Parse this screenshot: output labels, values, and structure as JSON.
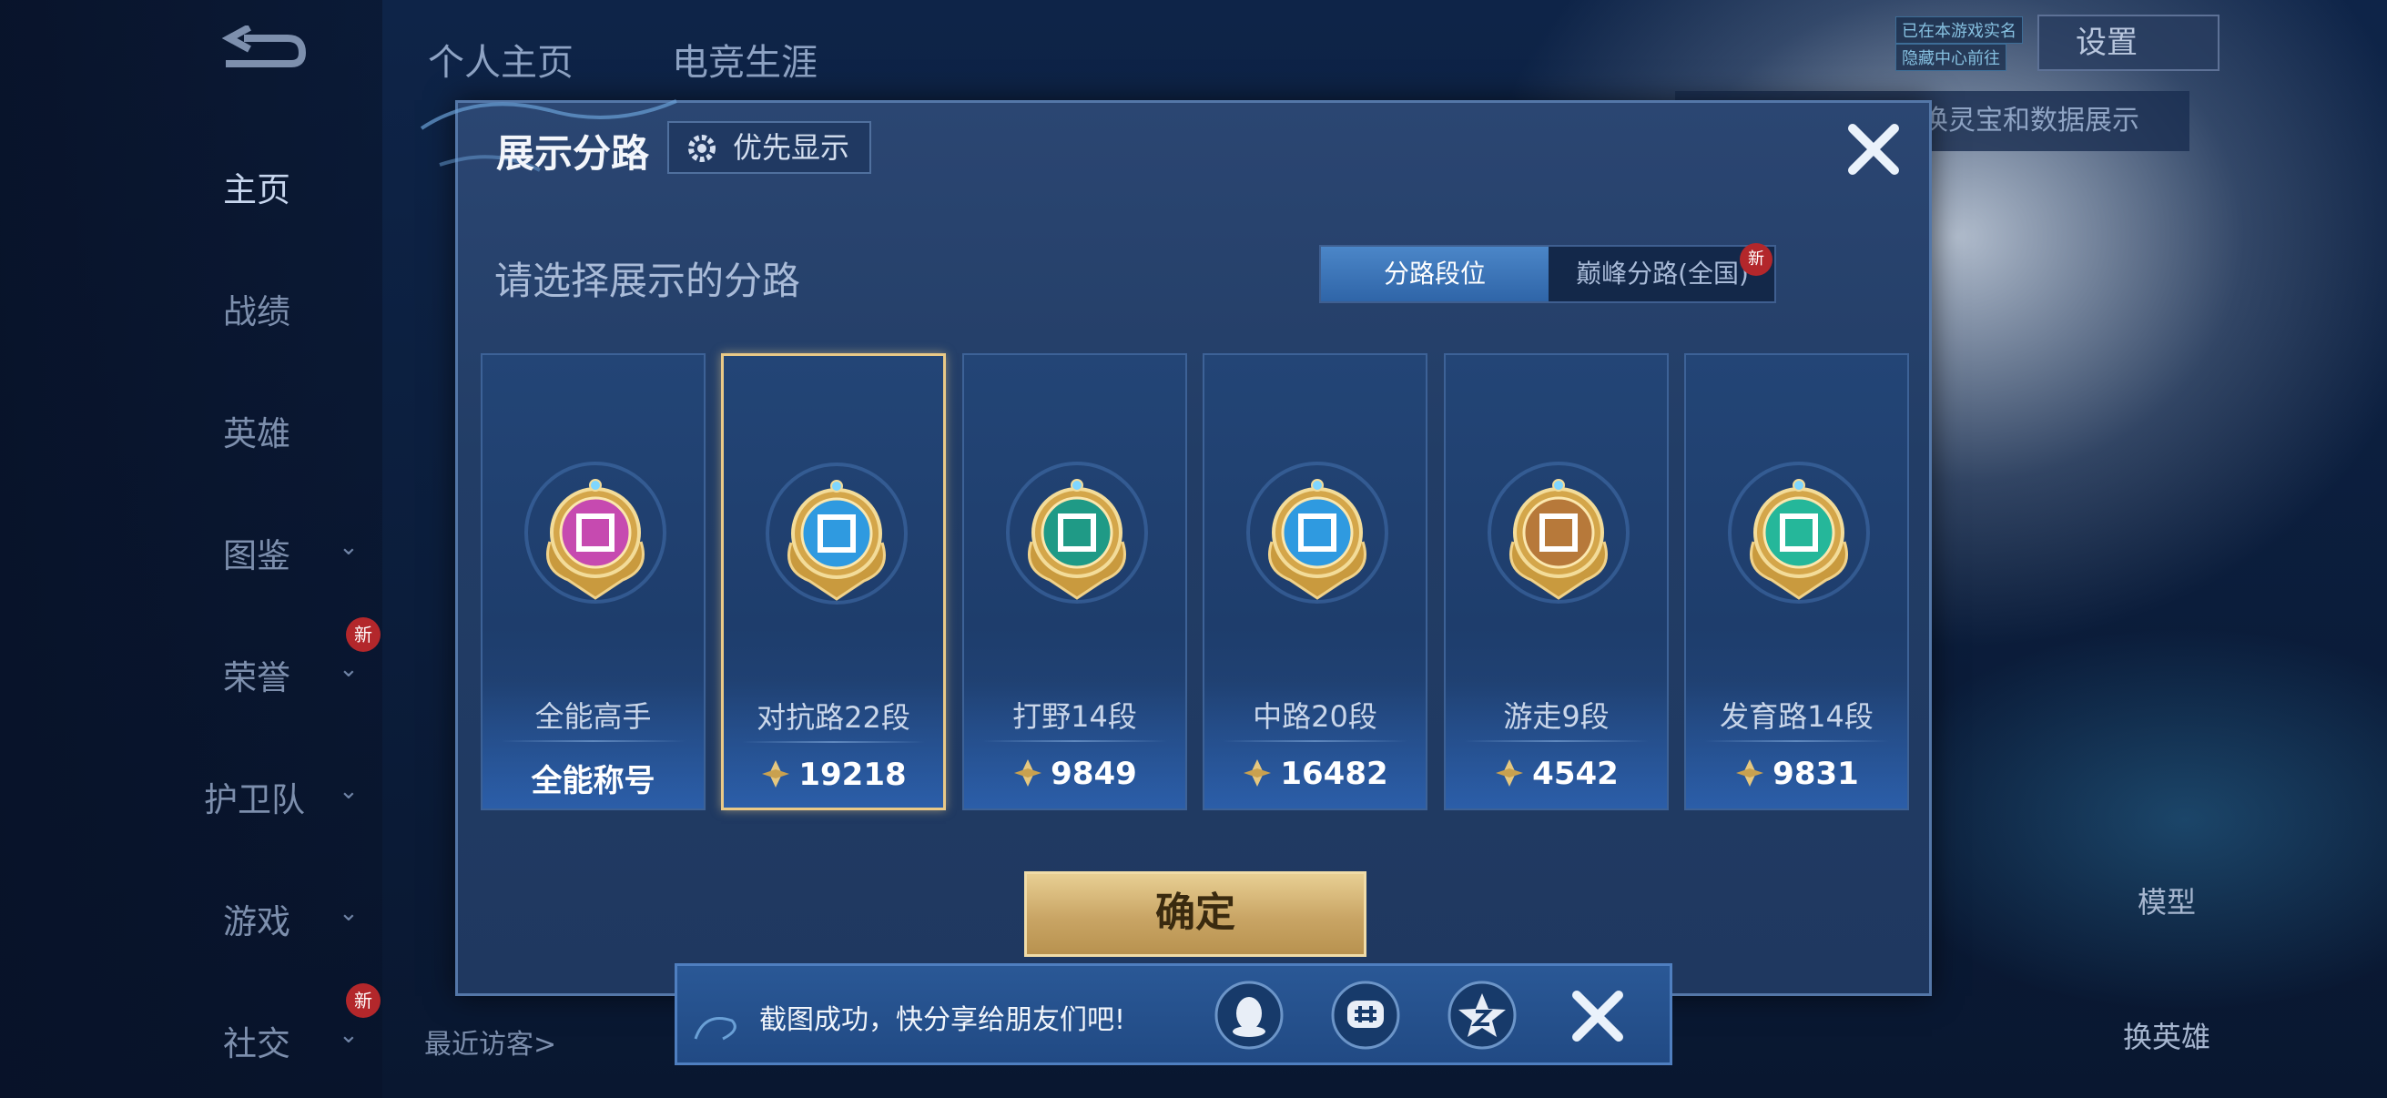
{
  "background": {
    "top_tabs": [
      "个人主页",
      "电竞生涯"
    ],
    "sidebar": [
      {
        "label": "主页",
        "active": true
      },
      {
        "label": "战绩"
      },
      {
        "label": "英雄"
      },
      {
        "label": "图鉴"
      },
      {
        "label": "荣誉"
      },
      {
        "label": "护卫队"
      },
      {
        "label": "游戏"
      },
      {
        "label": "社交"
      }
    ],
    "new_badge": "新",
    "settings_label": "设置",
    "tag_line1": "已在本游戏实名",
    "tag_line2": "隐藏中心前往",
    "banner_text": "换灵宝和数据展示",
    "model_label": "模型",
    "change_hero_label": "换英雄",
    "recent_visitors": "最近访客>"
  },
  "modal": {
    "title": "展示分路",
    "priority_label": "优先显示",
    "subtitle": "请选择展示的分路",
    "toggle": {
      "active": "分路段位",
      "inactive": "巅峰分路(全国)",
      "new_badge": "新"
    },
    "confirm_label": "确定",
    "cards": [
      {
        "name": "全能高手",
        "value": "全能称号",
        "has_icon": false,
        "emblem_color": "#c64ab0",
        "emblem": "allround-emblem-icon"
      },
      {
        "name": "对抗路22段",
        "value": "19218",
        "has_icon": true,
        "emblem_color": "#2f9ae0",
        "emblem": "clash-lane-emblem-icon",
        "selected": true
      },
      {
        "name": "打野14段",
        "value": "9849",
        "has_icon": true,
        "emblem_color": "#1f9a86",
        "emblem": "jungle-emblem-icon"
      },
      {
        "name": "中路20段",
        "value": "16482",
        "has_icon": true,
        "emblem_color": "#2f9ae0",
        "emblem": "mid-lane-emblem-icon"
      },
      {
        "name": "游走9段",
        "value": "4542",
        "has_icon": true,
        "emblem_color": "#b7793a",
        "emblem": "roam-emblem-icon"
      },
      {
        "name": "发育路14段",
        "value": "9831",
        "has_icon": true,
        "emblem_color": "#25b79a",
        "emblem": "farm-lane-emblem-icon"
      }
    ]
  },
  "toast": {
    "message": "截图成功，快分享给朋友们吧!",
    "share_targets": [
      "qq-icon",
      "wechat-moments-icon",
      "qzone-icon"
    ]
  }
}
